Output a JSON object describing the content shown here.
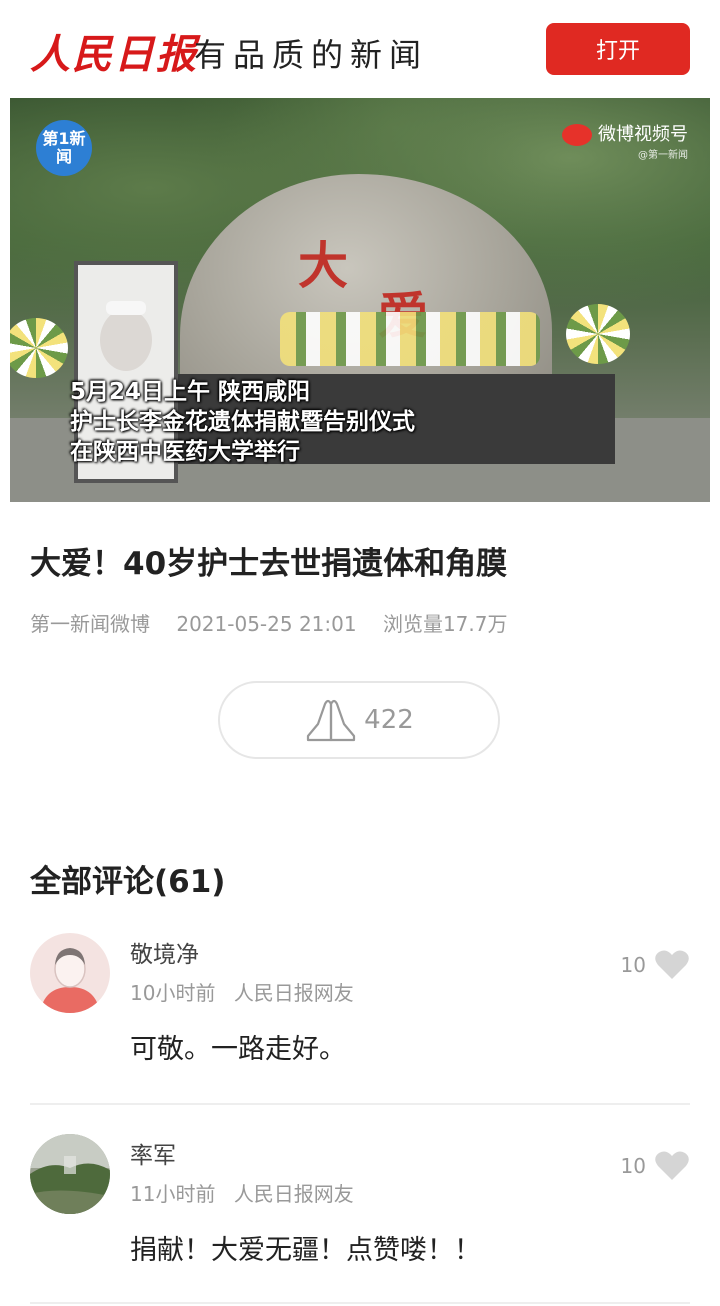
{
  "header": {
    "logo_text": "人民日报",
    "slogan": "有品质的新闻",
    "open_button": "打开",
    "brand_color": "#d7191a",
    "button_color": "#e02922"
  },
  "video": {
    "channel_badge": "第1新闻",
    "watermark": "微博视频号",
    "watermark_sub": "@第一新闻",
    "rock_chars": [
      "大",
      "爱"
    ],
    "caption_lines": [
      "5月24日上午 陕西咸阳",
      "护士长李金花遗体捐献暨告别仪式",
      "在陕西中医药大学举行"
    ]
  },
  "article": {
    "title": "大爱！40岁护士去世捐遗体和角膜",
    "source": "第一新闻微博",
    "datetime": "2021-05-25 21:01",
    "views": "浏览量17.7万",
    "pray_count": "422",
    "pray_icon": "praying-hands-icon"
  },
  "comments": {
    "heading": "全部评论(61)",
    "items": [
      {
        "name": "敬境净",
        "time": "10小时前",
        "role": "人民日报网友",
        "text": "可敬。一路走好。",
        "likes": "10",
        "avatar": "default-avatar-icon"
      },
      {
        "name": "率军",
        "time": "11小时前",
        "role": "人民日报网友",
        "text": "捐献！大爱无疆！点赞喽！！",
        "likes": "10",
        "avatar": "landscape-photo-avatar"
      }
    ]
  }
}
